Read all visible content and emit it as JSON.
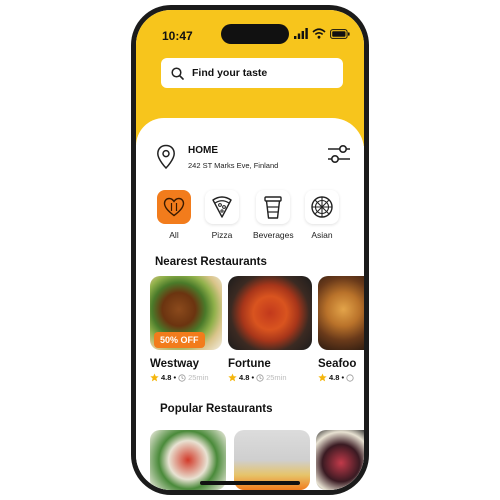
{
  "status_bar": {
    "time": "10:47",
    "icons": [
      "signal-icon",
      "wifi-icon",
      "battery-icon"
    ]
  },
  "search": {
    "label": "Find your taste",
    "icon": "search-icon"
  },
  "location": {
    "title": "HOME",
    "address": "242 ST Marks Eve, Finland",
    "icon": "location-pin-icon",
    "filter_icon": "filter-sliders-icon"
  },
  "categories": [
    {
      "label": "All",
      "icon": "heart-fork-icon",
      "active": true
    },
    {
      "label": "Pizza",
      "icon": "pizza-icon",
      "active": false
    },
    {
      "label": "Beverages",
      "icon": "cup-icon",
      "active": false
    },
    {
      "label": "Asian",
      "icon": "asian-dish-icon",
      "active": false
    }
  ],
  "nearest": {
    "title": "Nearest Restaurants",
    "items": [
      {
        "name": "Westway",
        "rating": "4.8",
        "duration": "25min",
        "badge": "50% OFF"
      },
      {
        "name": "Fortune",
        "rating": "4.8",
        "duration": "25min",
        "badge": ""
      },
      {
        "name": "Seafoo",
        "rating": "4.8",
        "duration": "",
        "badge": ""
      }
    ]
  },
  "popular": {
    "title": "Popular Restaurants"
  },
  "colors": {
    "brand_yellow": "#f7c51c",
    "accent_orange": "#f27c1c",
    "star_yellow": "#f5b60d"
  }
}
